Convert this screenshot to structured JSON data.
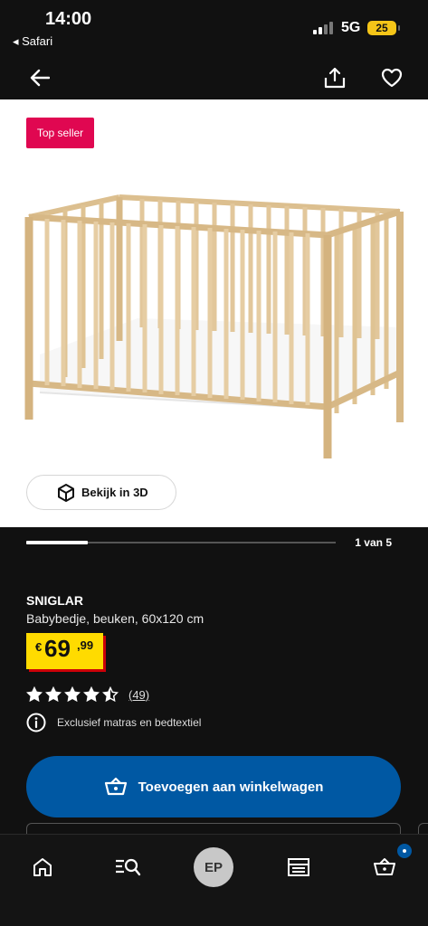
{
  "status_bar": {
    "time": "14:00",
    "back_app": "◂ Safari",
    "network": "5G",
    "battery": "25"
  },
  "product": {
    "badge": "Top seller",
    "view_3d_label": "Bekijk in 3D",
    "image_index_text": "1 van 5",
    "image_progress": 0.2,
    "name": "SNIGLAR",
    "description": "Babybedje, beuken, 60x120 cm",
    "price": {
      "currency": "€",
      "integer": "69",
      "decimal": ",99"
    },
    "rating": {
      "stars": 4.5,
      "max": 5,
      "count_text": "(49)"
    },
    "info_text": "Exclusief matras en bedtextiel",
    "add_to_cart_label": "Toevoegen aan winkelwagen"
  },
  "tab_bar": {
    "avatar_initials": "EP",
    "items": [
      "home-icon",
      "search-list-icon",
      "profile-avatar",
      "store-icon",
      "cart-icon"
    ]
  },
  "colors": {
    "background": "#111111",
    "badge": "#e00751",
    "price_bg": "#ffdb00",
    "price_shadow": "#cc0008",
    "primary": "#0058a3"
  }
}
